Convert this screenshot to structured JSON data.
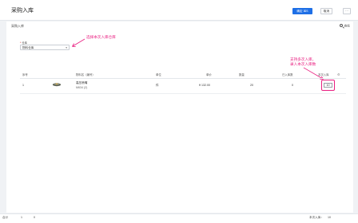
{
  "header": {
    "title": "采购入库",
    "confirm_label": "确定 ⌘S",
    "cancel_label": "取消",
    "more_label": "···"
  },
  "section": {
    "title": "采购入库",
    "search_label": "查找"
  },
  "warehouse": {
    "required_mark": "*",
    "label": "仓库",
    "value": "物料仓库",
    "caret": "▾"
  },
  "annotations": {
    "select_warehouse": "选择本次入库仓库",
    "qty_line1": "支持多次入库，",
    "qty_line2": "录入本次入库数",
    "color": "#e91e80"
  },
  "table": {
    "headers": [
      "序号",
      "物料名（编号）",
      "单位",
      "单价",
      "数量",
      "已入库数",
      "本次入库"
    ],
    "settings_icon": "⚙",
    "rows": [
      {
        "index": "1",
        "image": "product-thumbnail",
        "name": "高压喷嘴",
        "code": "M634 (2)",
        "unit": "件",
        "price": "¥ 132.00",
        "qty": "20",
        "received": "0",
        "this_time": "10"
      }
    ]
  },
  "footer": {
    "total_label": "合计",
    "total_value": "1",
    "zero_value": "0",
    "in_label": "本次入库：",
    "in_value": "10"
  },
  "colors": {
    "primary": "#1e6fe6",
    "accent": "#e91e80"
  }
}
